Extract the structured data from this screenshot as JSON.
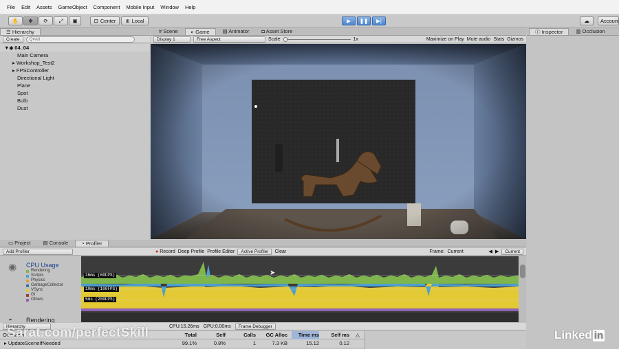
{
  "menu": [
    "File",
    "Edit",
    "Assets",
    "GameObject",
    "Component",
    "Mobile Input",
    "Window",
    "Help"
  ],
  "toolbar": {
    "center_label": "Center",
    "local_label": "Local",
    "account_label": "Account"
  },
  "hierarchy": {
    "tab_label": "Hierarchy",
    "create_label": "Create",
    "search_placeholder": "Q▾All",
    "scene_name": "04_04",
    "items": [
      "Main Camera",
      "Workshop_Test2",
      "FPSController",
      "Directional Light",
      "Plane",
      "Spot",
      "Bulb",
      "Dust"
    ]
  },
  "center_tabs": [
    "Scene",
    "Game",
    "Animator",
    "Asset Store"
  ],
  "game_bar": {
    "display": "Display 1",
    "aspect": "Free Aspect",
    "scale_label": "Scale",
    "scale_value": "1x",
    "buttons": [
      "Maximize on Play",
      "Mute audio",
      "Stats",
      "Gizmos"
    ]
  },
  "right_tabs": [
    "Inspector",
    "Occlusion"
  ],
  "bottom_tabs": [
    "Project",
    "Console",
    "Profiler"
  ],
  "profiler_bar": {
    "add_profiler": "Add Profiler",
    "record": "Record",
    "deep_profile": "Deep Profile",
    "profile_editor": "Profile Editor",
    "active_profiler": "Active Profiler",
    "clear": "Clear",
    "frame_label": "Frame:",
    "frame_value": "Current",
    "current_btn": "Current"
  },
  "cpu_usage": {
    "title": "CPU Usage",
    "legend": [
      {
        "label": "Rendering",
        "color": "#7fb54d"
      },
      {
        "label": "Scripts",
        "color": "#4d9fd1"
      },
      {
        "label": "Physics",
        "color": "#e39a3a"
      },
      {
        "label": "GarbageCollector",
        "color": "#3a6fb0"
      },
      {
        "label": "VSync",
        "color": "#e3c933"
      },
      {
        "label": "GI",
        "color": "#a13a3a"
      },
      {
        "label": "Others",
        "color": "#8f64b5"
      }
    ],
    "lines": [
      "16ms (60FPS)",
      "10ms (100FPS)",
      "5ms (200FPS)"
    ]
  },
  "rendering_label": "Rendering",
  "profiler_footer": {
    "hierarchy_drop": "Hierarchy",
    "cpu_time": "CPU:15.26ms",
    "gpu_time": "GPU:0.00ms",
    "frame_debugger": "Frame Debugger"
  },
  "table": {
    "headers": [
      "Overview",
      "Total",
      "Self",
      "Calls",
      "GC Alloc",
      "Time ms",
      "Self ms"
    ],
    "rows": [
      {
        "name": "UpdateSceneIfNeeded",
        "total": "99.1%",
        "self": "0.8%",
        "calls": "1",
        "gc": "7.3 KB",
        "time": "15.12",
        "self_ms": "0.12"
      }
    ]
  },
  "watermark": "Sarat.com/perfectSkill",
  "brand": "Linked in"
}
